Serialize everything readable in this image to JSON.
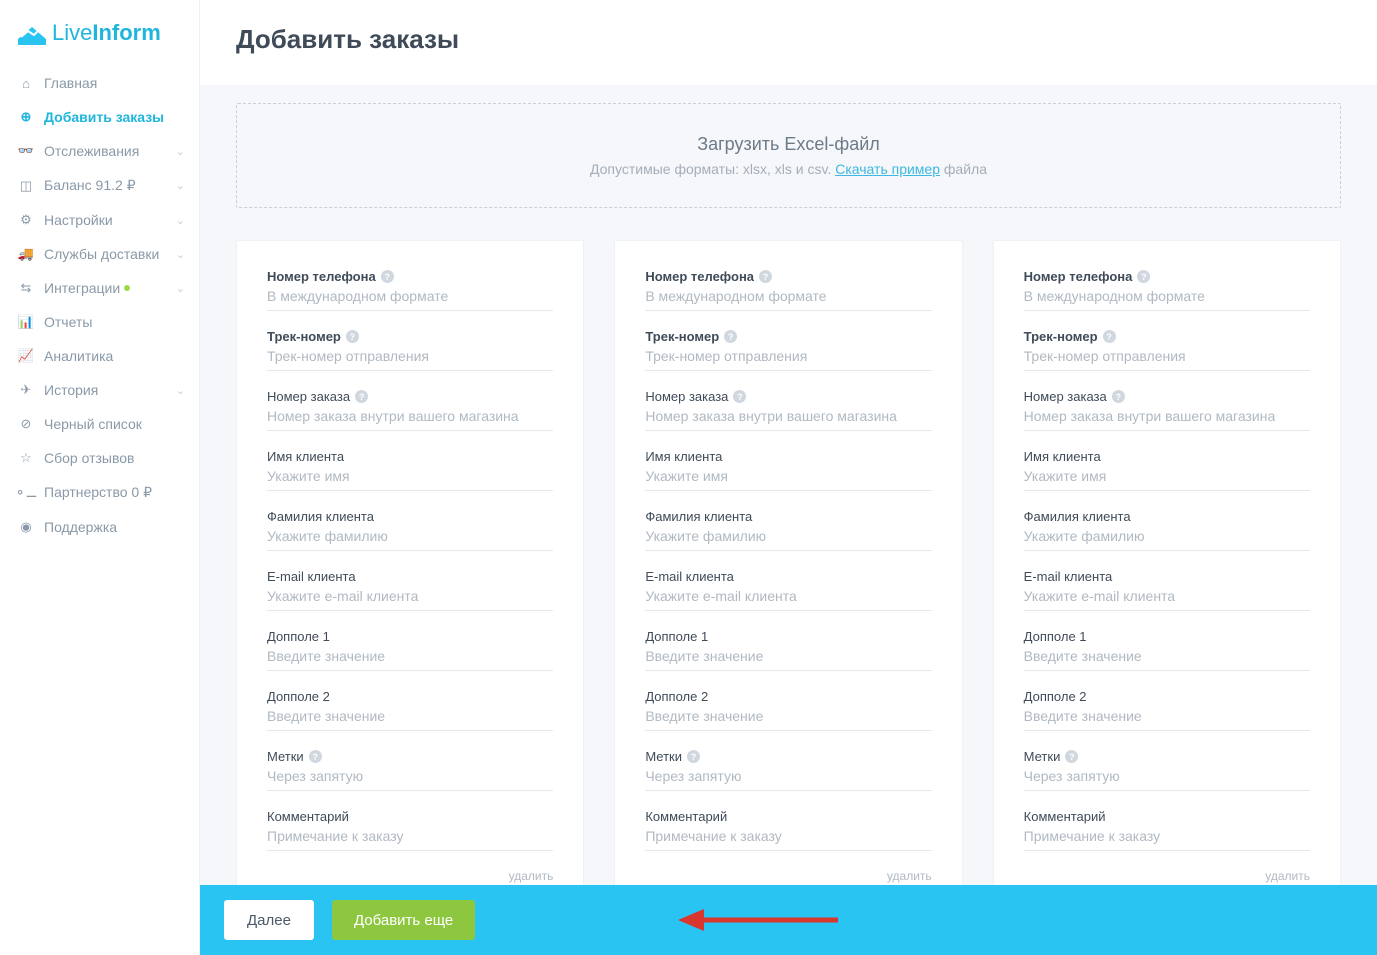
{
  "logo": {
    "part1": "Live",
    "part2": "Inform"
  },
  "sidebar": {
    "items": [
      {
        "label": "Главная"
      },
      {
        "label": "Добавить заказы"
      },
      {
        "label": "Отслеживания"
      },
      {
        "label": "Баланс 91.2 ₽"
      },
      {
        "label": "Настройки"
      },
      {
        "label": "Службы доставки"
      },
      {
        "label": "Интеграции"
      },
      {
        "label": "Отчеты"
      },
      {
        "label": "Аналитика"
      },
      {
        "label": "История"
      },
      {
        "label": "Черный список"
      },
      {
        "label": "Сбор отзывов"
      },
      {
        "label": "Партнерство 0 ₽"
      },
      {
        "label": "Поддержка"
      }
    ]
  },
  "page": {
    "title": "Добавить заказы"
  },
  "upload": {
    "title": "Загрузить Excel-файл",
    "sub_prefix": "Допустимые форматы: xlsx, xls и csv. ",
    "link": "Скачать пример",
    "sub_suffix": " файла"
  },
  "fields": [
    {
      "label": "Номер телефона",
      "bold": true,
      "help": true,
      "placeholder": "В международном формате"
    },
    {
      "label": "Трек-номер",
      "bold": true,
      "help": true,
      "placeholder": "Трек-номер отправления"
    },
    {
      "label": "Номер заказа",
      "bold": false,
      "help": true,
      "placeholder": "Номер заказа внутри вашего магазина"
    },
    {
      "label": "Имя клиента",
      "bold": false,
      "help": false,
      "placeholder": "Укажите имя"
    },
    {
      "label": "Фамилия клиента",
      "bold": false,
      "help": false,
      "placeholder": "Укажите фамилию"
    },
    {
      "label": "E-mail клиента",
      "bold": false,
      "help": false,
      "placeholder": "Укажите e-mail клиента"
    },
    {
      "label": "Допполе 1",
      "bold": false,
      "help": false,
      "placeholder": "Введите значение"
    },
    {
      "label": "Допполе 2",
      "bold": false,
      "help": false,
      "placeholder": "Введите значение"
    },
    {
      "label": "Метки",
      "bold": false,
      "help": true,
      "placeholder": "Через запятую"
    },
    {
      "label": "Комментарий",
      "bold": false,
      "help": false,
      "placeholder": "Примечание к заказу"
    }
  ],
  "card": {
    "delete": "удалить"
  },
  "bottom": {
    "next": "Далее",
    "add_more": "Добавить еще"
  }
}
